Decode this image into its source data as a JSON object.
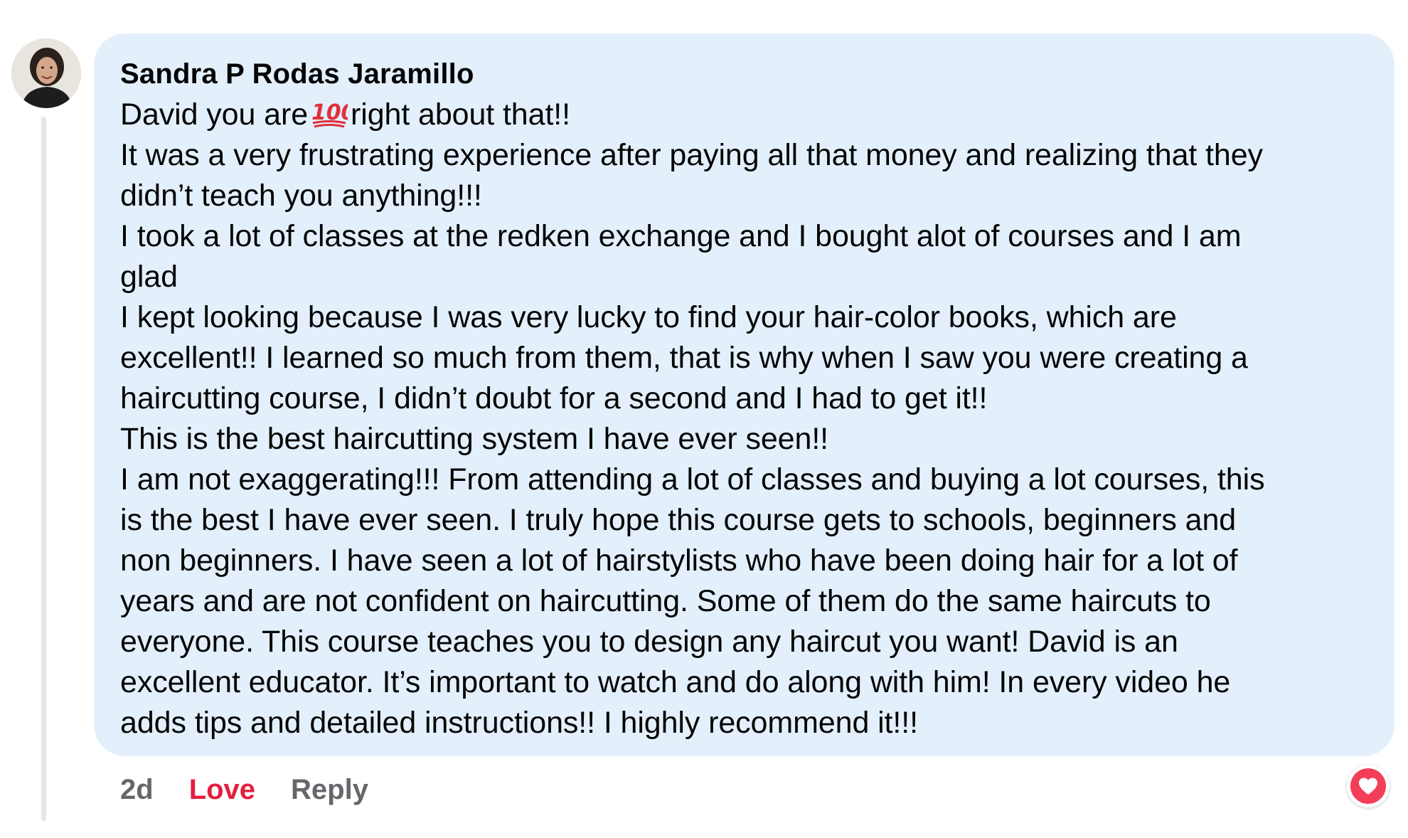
{
  "comment": {
    "author": "Sandra P Rodas Jaramillo",
    "lines": [
      "David you are",
      "right about that!!",
      "It was a very frustrating experience after paying all that money and realizing that they",
      "didn’t teach you anything!!!",
      "I took a lot of classes at the redken exchange and I bought alot of courses and I am",
      "glad",
      "I kept looking because I was very lucky to find your hair-color books, which are",
      "excellent!! I learned so much from them, that is why when I saw you were creating a",
      "haircutting course, I didn’t doubt for a second and I had to get it!!",
      "This is the best haircutting system I have ever seen!!",
      "I am not exaggerating!!! From attending a lot of classes and buying a lot courses, this",
      "is the best I have ever seen. I truly hope this course gets to schools, beginners and",
      "non beginners. I have seen a lot of hairstylists who have been doing hair for a lot of",
      "years and are not confident on haircutting. Some of them do the same haircuts to",
      "everyone. This course teaches you to design any haircut you want! David is an",
      "excellent educator. It’s important to watch and do along with him! In every video he",
      "adds tips and detailed instructions!! I highly recommend it!!!"
    ],
    "inline_emoji": "hundred-points-emoji"
  },
  "actions": {
    "time": "2d",
    "love_label": "Love",
    "reply_label": "Reply"
  },
  "reaction": {
    "icon": "heart-icon",
    "color": "#f33e58"
  },
  "colors": {
    "bubble_bg": "#e3f0fc",
    "love_red": "#e41e3f",
    "muted_gray": "#65676b"
  }
}
